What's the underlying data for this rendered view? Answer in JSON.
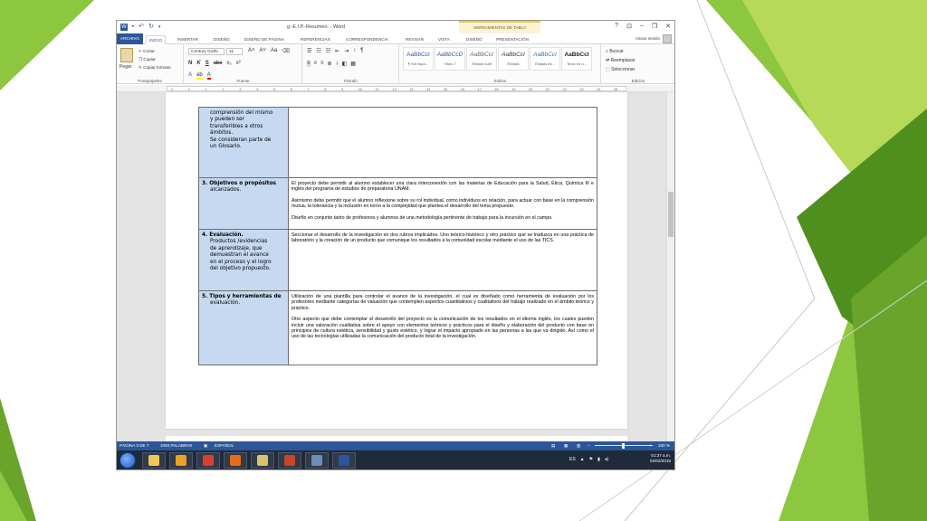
{
  "colors": {
    "word_blue": "#2b579a",
    "label_cell": "#c5d9f1",
    "green_light": "#8dc63f",
    "green_dark": "#4e8f1e"
  },
  "window": {
    "quick_access": [
      "save-icon",
      "undo-icon",
      "redo-icon"
    ],
    "title": "g.-E.I.P.-Resumen. - Word",
    "contextual_group": "HERRAMIENTAS DE TABLA",
    "controls": [
      "?",
      "⊡",
      "–",
      "❐",
      "✕"
    ]
  },
  "tabs": {
    "file": "ARCHIVO",
    "items": [
      "INICIO",
      "INSERTAR",
      "DISEÑO",
      "DISEÑO DE PÁGINA",
      "REFERENCIAS",
      "CORRESPONDENCIA",
      "REVISAR",
      "VISTA",
      "DISEÑO",
      "PRESENTACIÓN"
    ],
    "signin": "Iniciar sesión"
  },
  "ribbon": {
    "clipboard": {
      "paste": "Pegar",
      "cut": "Cortar",
      "copy": "Copiar",
      "format_painter": "Copiar formato",
      "label": "Portapapeles"
    },
    "font": {
      "name": "Century Gothi",
      "size": "11",
      "label": "Fuente"
    },
    "paragraph": {
      "label": "Párrafo"
    },
    "styles": {
      "label": "Estilos",
      "items": [
        {
          "preview": "AaBbCcI",
          "name": "¶ Sin espa..."
        },
        {
          "preview": "AaBbCcD",
          "name": "Título 7"
        },
        {
          "preview": "AaBbCcI",
          "name": "Énfasis sutil"
        },
        {
          "preview": "AaBbCcI",
          "name": "Énfasis"
        },
        {
          "preview": "AaBbCcI",
          "name": "Énfasis int..."
        },
        {
          "preview": "AaBbCcI",
          "name": "Texto en n..."
        }
      ]
    },
    "editing": {
      "find": "Buscar",
      "replace": "Reemplazar",
      "select": "Seleccionar",
      "label": "Edición"
    }
  },
  "ruler": {
    "numbers": [
      "2",
      "1",
      "1",
      "2",
      "3",
      "4",
      "5",
      "6",
      "7",
      "8",
      "9",
      "10",
      "11",
      "12",
      "13",
      "14",
      "15",
      "16",
      "17",
      "18",
      "19",
      "20",
      "21",
      "22",
      "23",
      "24",
      "25"
    ]
  },
  "table": {
    "rows": [
      {
        "label_title": "",
        "label_lines": [
          "comprensión del mismo",
          "y pueden ser",
          "transferibles a otros",
          "ámbitos.",
          "Se consideran parte de",
          "un Glosario."
        ],
        "paragraphs": []
      },
      {
        "label_title": "3. Objetivos o propósitos",
        "label_lines": [
          "alcanzados."
        ],
        "paragraphs": [
          "El proyecto debe permitir al alumno establecer una clara interconexión con las materias de Educación para la Salud, Ética, Química III e inglés del programa de estudios de preparatoria UNAM.",
          "Asimismo debe permitir que el alumno reflexione sobre su rol individual, como individuos en relación, para actuar con base en la comprensión mutua, la tolerancia y la inclusión en torno a la complejidad que plantea el desarrollo del tema propuesto.",
          "Diseño en conjunto tanto de profesores y alumnos de una metodología pertinente de trabajo para la incursión en el campo."
        ]
      },
      {
        "label_title": "4. Evaluación.",
        "label_lines": [
          "Productos /evidencias",
          "de aprendizaje, que",
          "demuestran el avance",
          "en el proceso y el logro",
          "del objetivo propuesto."
        ],
        "paragraphs": [
          "Seccionar el desarrollo de la investigación en dos rubros implicados. Uno teórico-histórico y otro práctico que se traduzca en una práctica de laboratorio y la creación de un producto que comunique los resultados a la comunidad escolar mediante el uso de las TICS."
        ]
      },
      {
        "label_title": "5. Tipos y herramientas de",
        "label_lines": [
          "evaluación."
        ],
        "paragraphs": [
          "Utilización de una plantilla para controlar el avance de la investigación, el cual es diseñado como herramienta de evaluación por los profesores mediante categorías de valuación que contemplen aspectos cuantitativos y cualitativos del trabajo realizado en el ámbito teórico y práctico.",
          "Otro aspecto que debe contemplar el desarrollo del proyecto es la comunicación de los resultados en el idioma inglés, los cuales pueden incluir una valoración cualitativa sobre el apoyo con elementos teóricos y prácticos para el diseño y elaboración del producto con base en principios de cultura estética, sensibilidad y gusto estético, y lograr el impacto apropiado en las personas a las que va dirigido. Así como el uso de las tecnologías utilizadas la comunicación del producto total de la investigación."
        ]
      }
    ]
  },
  "status": {
    "page": "PÁGINA 3 DE 7",
    "words": "1093 PALABRAS",
    "language": "ESPAÑOL",
    "zoom": "100 %"
  },
  "taskbar": {
    "apps": [
      "explorer-icon",
      "media-player-icon",
      "chrome-icon",
      "firefox-icon",
      "folder-icon",
      "powerpoint-icon",
      "window-icon",
      "word-icon"
    ],
    "lang": "ES",
    "time": "01:37 a.m.",
    "date": "02/02/2018"
  }
}
